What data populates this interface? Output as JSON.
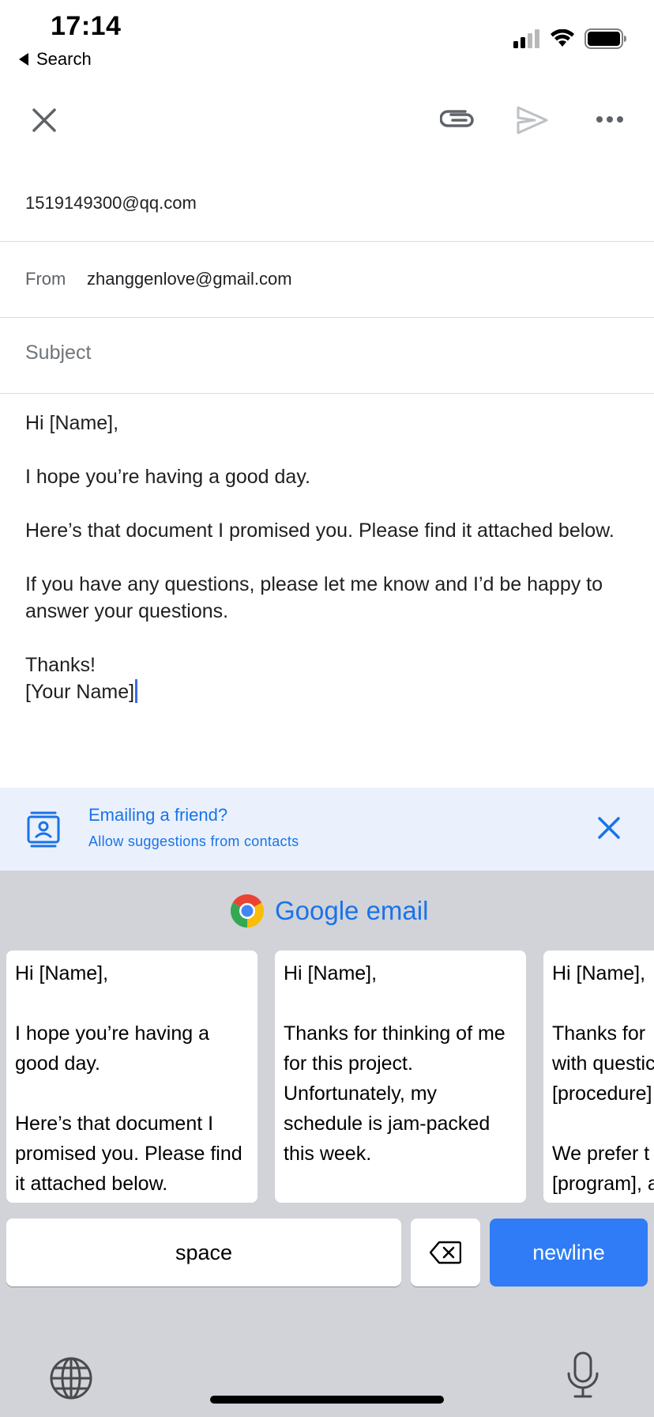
{
  "status_bar": {
    "time": "17:14",
    "back_app": "Search",
    "icons": [
      "signal-icon",
      "wifi-icon",
      "battery-icon"
    ]
  },
  "toolbar": {
    "close_icon": "close-icon",
    "attach_icon": "paperclip-icon",
    "send_icon": "send-icon",
    "more_icon": "more-horizontal-icon"
  },
  "compose": {
    "to": "1519149300@qq.com",
    "from_label": "From",
    "from_value": "zhanggenlove@gmail.com",
    "subject_placeholder": "Subject",
    "body": {
      "greeting": "Hi [Name],",
      "line1": "I hope you’re having a good day.",
      "line2": "Here’s that document I promised you. Please find it attached below.",
      "line3": "If you have any questions, please let me know and I’d be happy to answer your questions.",
      "signoff": "Thanks!",
      "signature": "[Your Name]"
    }
  },
  "suggestion_banner": {
    "title": "Emailing a friend?",
    "subtitle": "Allow suggestions from contacts"
  },
  "keyboard": {
    "title": "Google email",
    "cards": [
      {
        "text": "Hi [Name],\n\nI hope you’re having a good day.\n\nHere’s that document I promised you. Please find it attached below."
      },
      {
        "text": "Hi [Name],\n\nThanks for thinking of me for this project. Unfortunately, my schedule is jam-packed this week."
      },
      {
        "text": "Hi [Name],\n\nThanks for\nwith questic\n[procedure]\n\nWe prefer t\n[program], a"
      }
    ],
    "space_label": "space",
    "newline_label": "newline"
  },
  "colors": {
    "accent": "#1a73e8",
    "banner_bg": "#eaf1fc",
    "keyboard_bg": "#d1d3d9",
    "newline_key": "#2f7cf6"
  }
}
